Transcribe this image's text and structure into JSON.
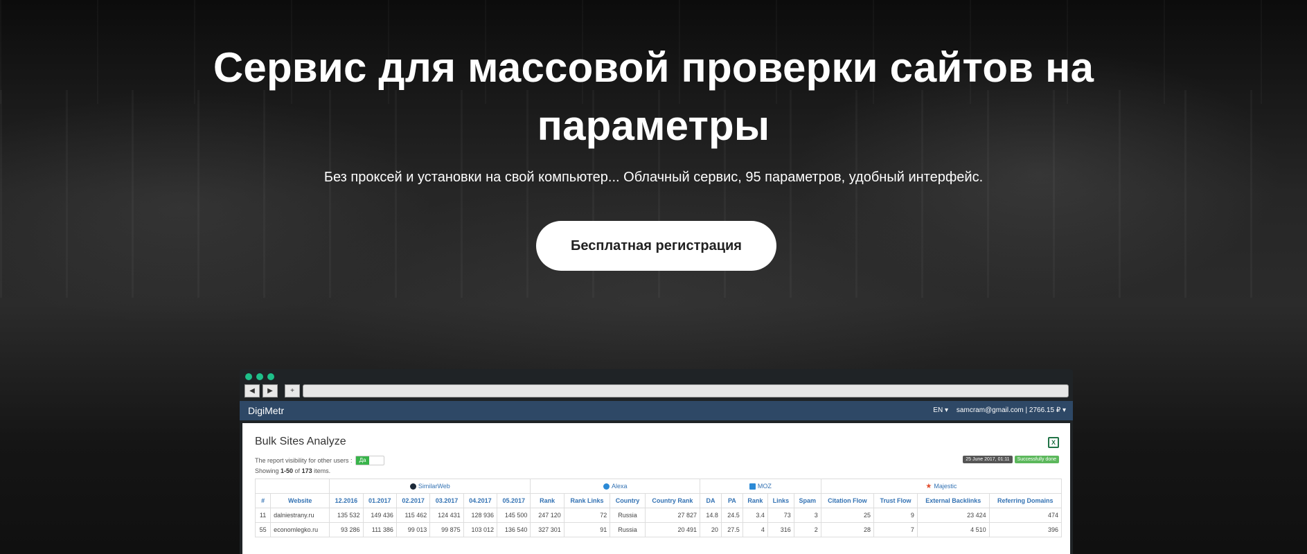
{
  "hero": {
    "title": "Сервис для массовой проверки сайтов на параметры",
    "subtitle": "Без проксей и установки на свой компьютер... Облачный сервис, 95 параметров, удобный интерфейс.",
    "cta_label": "Бесплатная регистрация"
  },
  "browser": {
    "back": "◀",
    "forward": "▶",
    "new_tab": "+"
  },
  "app": {
    "brand": "DigiMetr",
    "lang": "EN ▾",
    "account": "samcram@gmail.com | 2766.15 ₽ ▾",
    "page_title": "Bulk Sites Analyze",
    "visibility_label": "The report visibility for other users :",
    "visibility_value": "Да",
    "date_badge": "25 June 2017, 01:11",
    "status_badge": "Successfully done",
    "showing_prefix": "Showing ",
    "showing_range": "1-50",
    "showing_of": " of ",
    "showing_total": "173",
    "showing_suffix": " items."
  },
  "table": {
    "groups": [
      {
        "label": "SimilarWeb",
        "icon": "similarweb-icon"
      },
      {
        "label": "Alexa",
        "icon": "alexa-icon"
      },
      {
        "label": "MOZ",
        "icon": "moz-icon"
      },
      {
        "label": "Majestic",
        "icon": "majestic-icon"
      }
    ],
    "headers": [
      "#",
      "Website",
      "12.2016",
      "01.2017",
      "02.2017",
      "03.2017",
      "04.2017",
      "05.2017",
      "Rank",
      "Rank Links",
      "Country",
      "Country Rank",
      "DA",
      "PA",
      "Rank",
      "Links",
      "Spam",
      "Citation Flow",
      "Trust Flow",
      "External Backlinks",
      "Referring Domains"
    ],
    "rows": [
      [
        "11",
        "dalniestrany.ru",
        "135 532",
        "149 436",
        "115 462",
        "124 431",
        "128 936",
        "145 500",
        "247 120",
        "72",
        "Russia",
        "27 827",
        "14.8",
        "24.5",
        "3.4",
        "73",
        "3",
        "25",
        "9",
        "23 424",
        "474"
      ],
      [
        "55",
        "economlegko.ru",
        "93 286",
        "111 386",
        "99 013",
        "99 875",
        "103 012",
        "136 540",
        "327 301",
        "91",
        "Russia",
        "20 491",
        "20",
        "27.5",
        "4",
        "316",
        "2",
        "28",
        "7",
        "4 510",
        "396"
      ]
    ]
  }
}
